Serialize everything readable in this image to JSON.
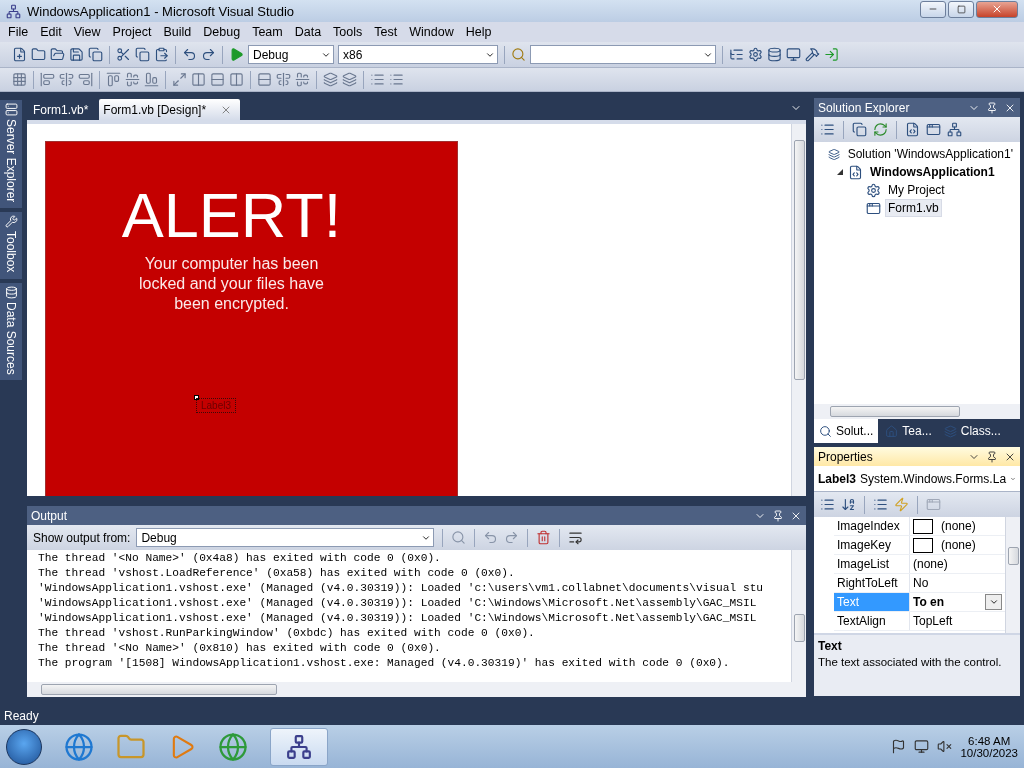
{
  "window": {
    "title": "WindowsApplication1 - Microsoft Visual Studio"
  },
  "menu": [
    "File",
    "Edit",
    "View",
    "Project",
    "Build",
    "Debug",
    "Team",
    "Data",
    "Tools",
    "Test",
    "Window",
    "Help"
  ],
  "toolbar": {
    "configuration": "Debug",
    "platform": "x86"
  },
  "side_tabs": [
    "Server Explorer",
    "Toolbox",
    "Data Sources"
  ],
  "document_tabs": [
    {
      "label": "Form1.vb*",
      "selected": false
    },
    {
      "label": "Form1.vb [Design]*",
      "selected": true
    }
  ],
  "form": {
    "heading": "ALERT!",
    "message": "Your computer has been locked and your files have been encrypted.",
    "label": "Label3"
  },
  "output": {
    "title": "Output",
    "source_label": "Show output from:",
    "source": "Debug",
    "lines": [
      "The thread '<No Name>' (0x4a8) has exited with code 0 (0x0).",
      "The thread 'vshost.LoadReference' (0xa58) has exited with code 0 (0x0).",
      "'WindowsApplication1.vshost.exe' (Managed (v4.0.30319)): Loaded 'c:\\users\\vm1.collabnet\\documents\\visual stu",
      "'WindowsApplication1.vshost.exe' (Managed (v4.0.30319)): Loaded 'C:\\Windows\\Microsoft.Net\\assembly\\GAC_MSIL",
      "'WindowsApplication1.vshost.exe' (Managed (v4.0.30319)): Loaded 'C:\\Windows\\Microsoft.Net\\assembly\\GAC_MSIL",
      "The thread 'vshost.RunParkingWindow' (0xbdc) has exited with code 0 (0x0).",
      "The thread '<No Name>' (0x810) has exited with code 0 (0x0).",
      "The program '[1508] WindowsApplication1.vshost.exe: Managed (v4.0.30319)' has exited with code 0 (0x0)."
    ]
  },
  "solution_explorer": {
    "title": "Solution Explorer",
    "tree": [
      {
        "label": "Solution 'WindowsApplication1'",
        "kind": "solution",
        "selected": false,
        "children": [
          {
            "label": "WindowsApplication1",
            "kind": "project",
            "selected": false,
            "expanded": true,
            "children": [
              {
                "label": "My Project",
                "kind": "settings",
                "selected": false
              },
              {
                "label": "Form1.vb",
                "kind": "form",
                "selected": true
              }
            ]
          }
        ]
      }
    ],
    "tabs": [
      {
        "label": "Solut...",
        "selected": true
      },
      {
        "label": "Tea...",
        "selected": false
      },
      {
        "label": "Class...",
        "selected": false
      }
    ]
  },
  "properties": {
    "title": "Properties",
    "object": "Label3",
    "type": "System.Windows.Forms.La",
    "rows": [
      {
        "name": "ImageIndex",
        "value": "(none)",
        "kind": "swatch",
        "selected": false
      },
      {
        "name": "ImageKey",
        "value": "(none)",
        "kind": "swatch",
        "selected": false
      },
      {
        "name": "ImageList",
        "value": "(none)",
        "kind": "plain",
        "selected": false
      },
      {
        "name": "RightToLeft",
        "value": "No",
        "kind": "plain",
        "selected": false
      },
      {
        "name": "Text",
        "value": "To en",
        "kind": "dropdown",
        "selected": true
      },
      {
        "name": "TextAlign",
        "value": "TopLeft",
        "kind": "plain",
        "selected": false
      }
    ],
    "description_title": "Text",
    "description": "The text associated with the control."
  },
  "status_bar": "Ready",
  "taskbar": {
    "time": "6:48 AM",
    "date": "10/30/2023"
  }
}
